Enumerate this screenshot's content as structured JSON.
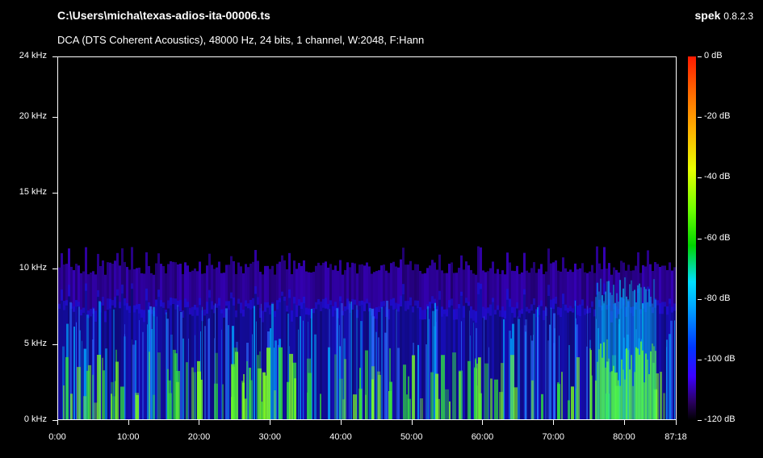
{
  "header": {
    "file_path": "C:\\Users\\micha\\texas-adios-ita-00006.ts",
    "stream_info": "DCA (DTS Coherent Acoustics), 48000 Hz, 24 bits, 1 channel, W:2048, F:Hann",
    "app_name": "spek",
    "app_version": "0.8.2.3"
  },
  "chart_data": {
    "type": "heatmap",
    "y_axis": {
      "ticks": [
        "24 kHz",
        "20 kHz",
        "15 kHz",
        "10 kHz",
        "5 kHz",
        "0 kHz"
      ],
      "ylim_khz": [
        0,
        24
      ]
    },
    "x_axis": {
      "ticks": [
        "0:00",
        "10:00",
        "20:00",
        "30:00",
        "40:00",
        "50:00",
        "60:00",
        "70:00",
        "80:00",
        "87:18"
      ],
      "duration": "87:18"
    },
    "colorbar": {
      "ticks": [
        "0 dB",
        "-20 dB",
        "-40 dB",
        "-60 dB",
        "-80 dB",
        "-100 dB",
        "-120 dB"
      ],
      "range_db": [
        -120,
        0
      ]
    },
    "content_cutoff_khz": 10
  },
  "colors": {
    "background": "#000000",
    "low": "#3d00ff",
    "mid": "#00d4ff",
    "high": "#70ff00"
  }
}
